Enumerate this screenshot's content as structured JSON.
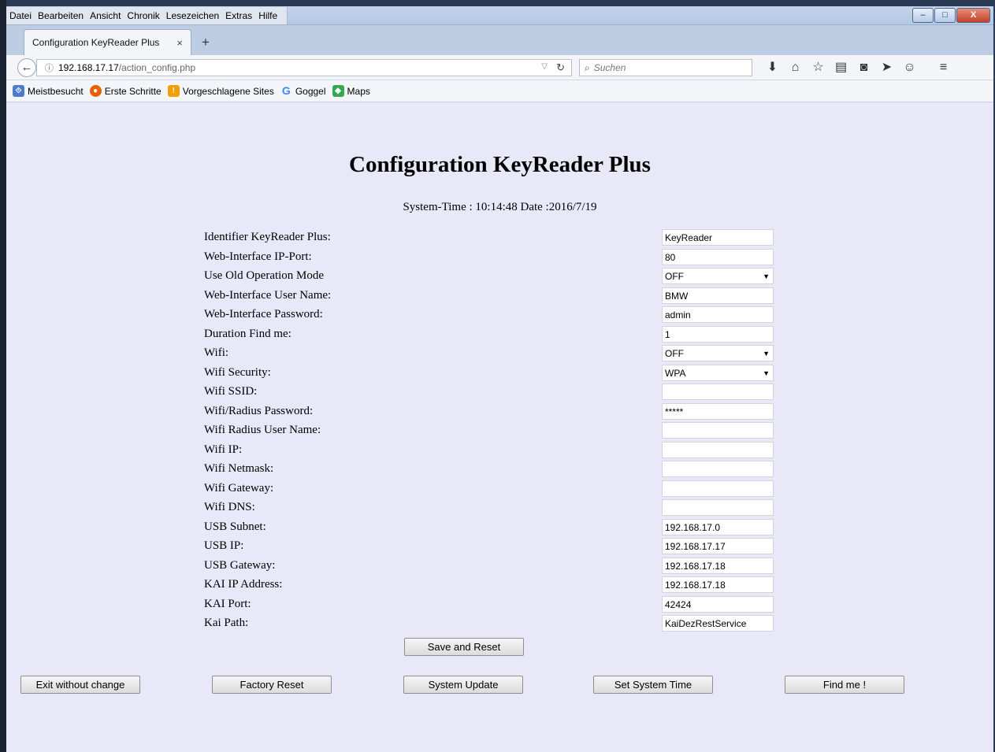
{
  "menu": [
    "Datei",
    "Bearbeiten",
    "Ansicht",
    "Chronik",
    "Lesezeichen",
    "Extras",
    "Hilfe"
  ],
  "window_controls": {
    "minimize": "–",
    "maximize": "□",
    "close": "X"
  },
  "tab": {
    "title": "Configuration KeyReader Plus",
    "close": "×",
    "new_tab": "+"
  },
  "nav": {
    "back": "←",
    "url_host": "192.168.17.17",
    "url_path": "/action_config.php",
    "search_placeholder": "Suchen"
  },
  "toolbar_icons": [
    "download-icon",
    "home-icon",
    "star-icon",
    "reading-list-icon",
    "pocket-icon",
    "send-icon",
    "chat-icon",
    "menu-icon"
  ],
  "bookmarks": [
    {
      "label": "Meistbesucht",
      "icon": "most-visited-icon",
      "color": "#4a7cc9"
    },
    {
      "label": "Erste Schritte",
      "icon": "firefox-icon",
      "color": "#e66000"
    },
    {
      "label": "Vorgeschlagene Sites",
      "icon": "suggested-icon",
      "color": "#f0a000"
    },
    {
      "label": "Goggel",
      "icon": "google-icon",
      "color": "#4285f4"
    },
    {
      "label": "Maps",
      "icon": "maps-icon",
      "color": "#34a853"
    }
  ],
  "page": {
    "title": "Configuration KeyReader Plus",
    "system_time": "System-Time : 10:14:48 Date :2016/7/19",
    "fields": [
      {
        "label": "Identifier KeyReader Plus:",
        "value": "KeyReader",
        "type": "text"
      },
      {
        "label": "Web-Interface IP-Port:",
        "value": "80",
        "type": "text"
      },
      {
        "label": "Use Old Operation Mode",
        "value": "OFF",
        "type": "select"
      },
      {
        "label": "Web-Interface User Name:",
        "value": "BMW",
        "type": "text"
      },
      {
        "label": "Web-Interface Password:",
        "value": "admin",
        "type": "text"
      },
      {
        "label": "Duration Find me:",
        "value": "1",
        "type": "text"
      },
      {
        "label": "Wifi:",
        "value": "OFF",
        "type": "select"
      },
      {
        "label": "Wifi Security:",
        "value": "WPA",
        "type": "select"
      },
      {
        "label": "Wifi SSID:",
        "value": "",
        "type": "text"
      },
      {
        "label": "Wifi/Radius Password:",
        "value": "*****",
        "type": "text"
      },
      {
        "label": "Wifi Radius User Name:",
        "value": "",
        "type": "text"
      },
      {
        "label": "Wifi IP:",
        "value": "",
        "type": "text"
      },
      {
        "label": "Wifi Netmask:",
        "value": "",
        "type": "text"
      },
      {
        "label": "Wifi Gateway:",
        "value": "",
        "type": "text"
      },
      {
        "label": "Wifi DNS:",
        "value": "",
        "type": "text"
      },
      {
        "label": "USB Subnet:",
        "value": "192.168.17.0",
        "type": "text"
      },
      {
        "label": "USB IP:",
        "value": "192.168.17.17",
        "type": "text"
      },
      {
        "label": "USB Gateway:",
        "value": "192.168.17.18",
        "type": "text"
      },
      {
        "label": "KAI IP Address:",
        "value": "192.168.17.18",
        "type": "text"
      },
      {
        "label": "KAI Port:",
        "value": "42424",
        "type": "text"
      },
      {
        "label": "Kai Path:",
        "value": "KaiDezRestService",
        "type": "text"
      }
    ],
    "buttons": {
      "save_reset": "Save and Reset",
      "exit": "Exit without change",
      "factory_reset": "Factory Reset",
      "system_update": "System Update",
      "set_time": "Set System Time",
      "find_me": "Find me !"
    }
  }
}
